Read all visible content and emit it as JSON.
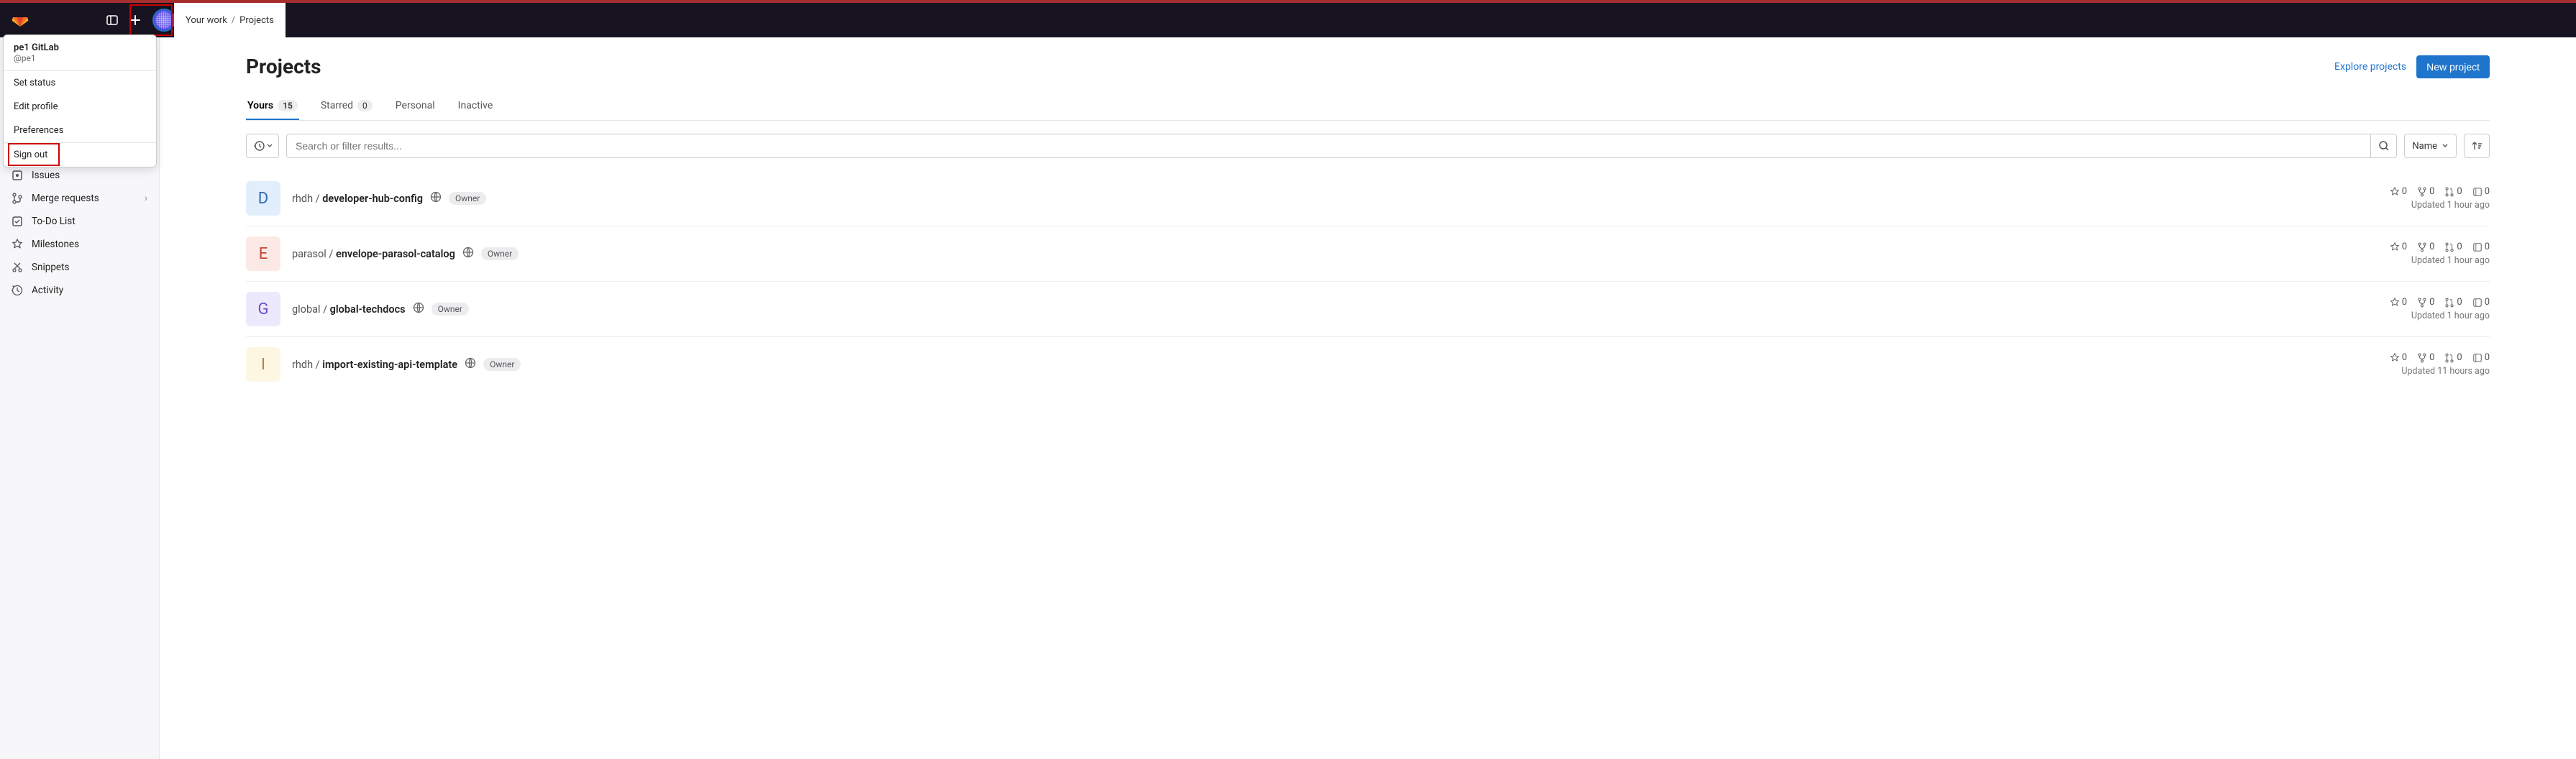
{
  "breadcrumb": {
    "root": "Your work",
    "page": "Projects"
  },
  "user_menu": {
    "display_name": "pe1 GitLab",
    "username": "@pe1",
    "items": {
      "set_status": "Set status",
      "edit_profile": "Edit profile",
      "preferences": "Preferences",
      "sign_out": "Sign out"
    }
  },
  "sidebar": {
    "items": [
      {
        "label": "Issues",
        "icon": "issues-icon"
      },
      {
        "label": "Merge requests",
        "icon": "merge-icon",
        "expandable": true
      },
      {
        "label": "To-Do List",
        "icon": "todo-icon"
      },
      {
        "label": "Milestones",
        "icon": "milestone-icon"
      },
      {
        "label": "Snippets",
        "icon": "snippet-icon"
      },
      {
        "label": "Activity",
        "icon": "activity-icon"
      }
    ]
  },
  "page": {
    "title": "Projects"
  },
  "actions": {
    "explore": "Explore projects",
    "new_project": "New project"
  },
  "tabs": {
    "yours": {
      "label": "Yours",
      "count": "15"
    },
    "starred": {
      "label": "Starred",
      "count": "0"
    },
    "personal": {
      "label": "Personal"
    },
    "inactive": {
      "label": "Inactive"
    }
  },
  "search": {
    "placeholder": "Search or filter results..."
  },
  "sort": {
    "label": "Name"
  },
  "projects": [
    {
      "avatar_letter": "D",
      "avatar_bg": "#e3eefc",
      "avatar_fg": "#2e6bb8",
      "namespace": "rhdh",
      "name": "developer-hub-config",
      "role": "Owner",
      "stars": "0",
      "forks": "0",
      "mrs": "0",
      "issues": "0",
      "updated": "Updated 1 hour ago"
    },
    {
      "avatar_letter": "E",
      "avatar_bg": "#fce9e6",
      "avatar_fg": "#c24a3a",
      "namespace": "parasol",
      "name": "envelope-parasol-catalog",
      "role": "Owner",
      "stars": "0",
      "forks": "0",
      "mrs": "0",
      "issues": "0",
      "updated": "Updated 1 hour ago"
    },
    {
      "avatar_letter": "G",
      "avatar_bg": "#ede9fc",
      "avatar_fg": "#6b4fc4",
      "namespace": "global",
      "name": "global-techdocs",
      "role": "Owner",
      "stars": "0",
      "forks": "0",
      "mrs": "0",
      "issues": "0",
      "updated": "Updated 1 hour ago"
    },
    {
      "avatar_letter": "I",
      "avatar_bg": "#fdf6e3",
      "avatar_fg": "#b0873a",
      "namespace": "rhdh",
      "name": "import-existing-api-template",
      "role": "Owner",
      "stars": "0",
      "forks": "0",
      "mrs": "0",
      "issues": "0",
      "updated": "Updated 11 hours ago"
    }
  ]
}
